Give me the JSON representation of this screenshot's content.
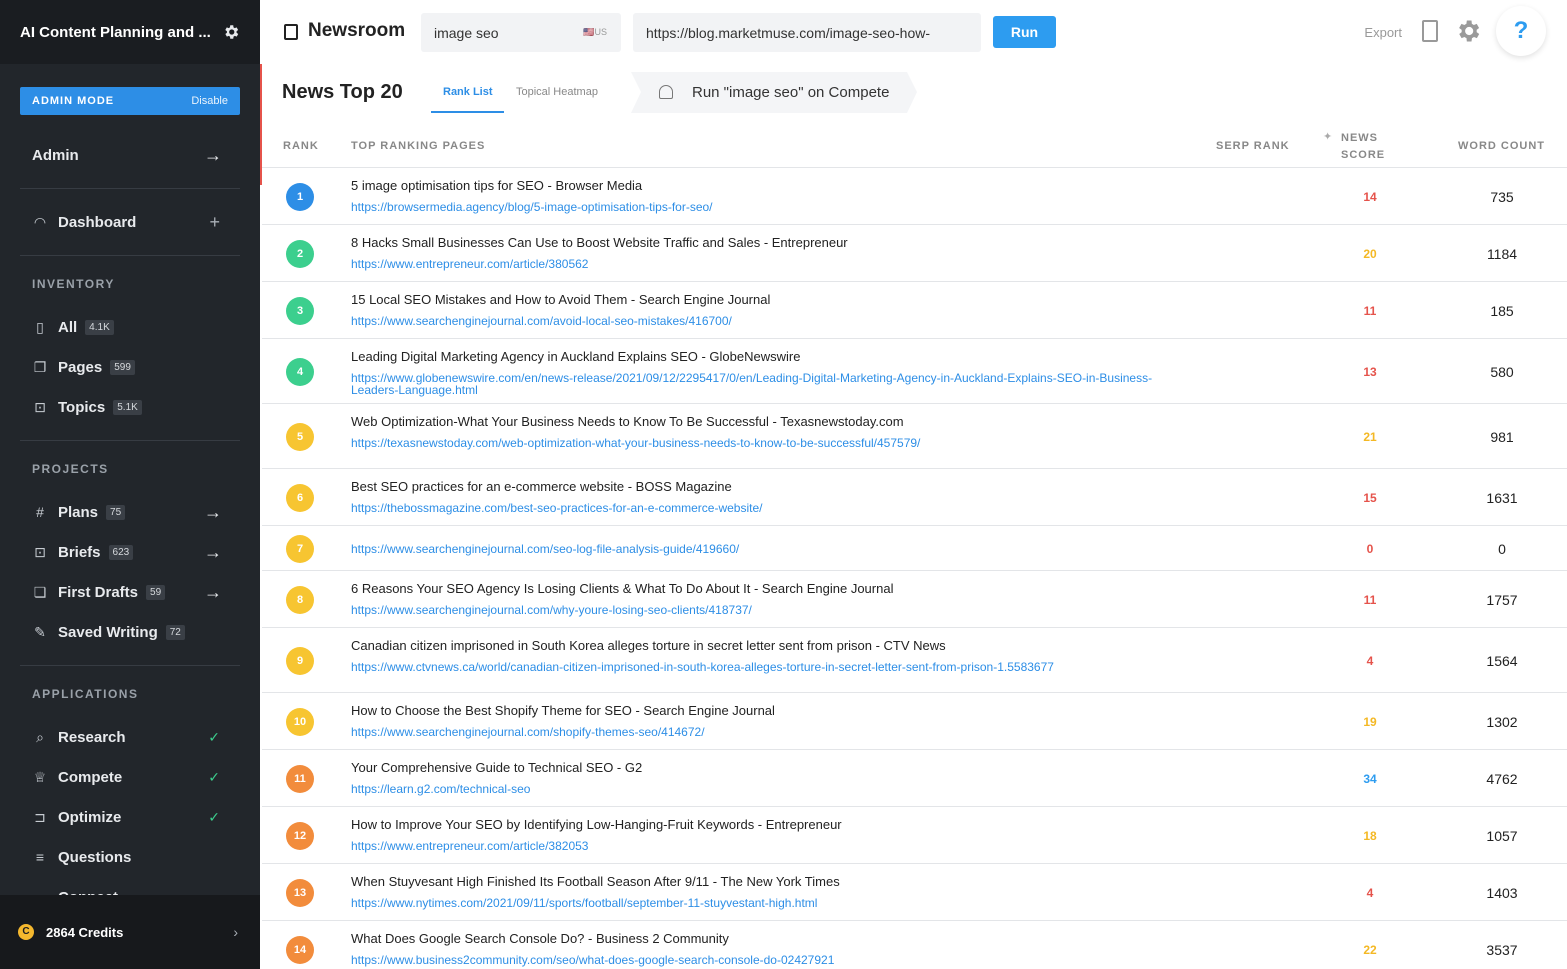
{
  "sidebar": {
    "title": "AI Content Planning and ...",
    "admin_mode_label": "ADMIN MODE",
    "admin_mode_action": "Disable",
    "admin_label": "Admin",
    "dashboard_label": "Dashboard",
    "inventory_heading": "INVENTORY",
    "inventory": [
      {
        "label": "All",
        "count": "4.1K",
        "icon": "bars-icon"
      },
      {
        "label": "Pages",
        "count": "599",
        "icon": "pages-icon"
      },
      {
        "label": "Topics",
        "count": "5.1K",
        "icon": "topics-icon"
      }
    ],
    "projects_heading": "PROJECTS",
    "projects": [
      {
        "label": "Plans",
        "count": "75",
        "icon": "hash-icon"
      },
      {
        "label": "Briefs",
        "count": "623",
        "icon": "brief-icon"
      },
      {
        "label": "First Drafts",
        "count": "59",
        "icon": "drafts-icon"
      },
      {
        "label": "Saved Writing",
        "count": "72",
        "icon": "edit-icon"
      }
    ],
    "applications_heading": "APPLICATIONS",
    "applications": [
      {
        "label": "Research",
        "icon": "search-icon"
      },
      {
        "label": "Compete",
        "icon": "trophy-icon"
      },
      {
        "label": "Optimize",
        "icon": "optimize-icon"
      },
      {
        "label": "Questions",
        "icon": "questions-icon"
      },
      {
        "label": "Connect",
        "icon": "connect-icon"
      }
    ],
    "credits": "2864 Credits",
    "credits_coin": "C"
  },
  "topbar": {
    "app_title": "Newsroom",
    "keyword": "image seo",
    "country": "🇺🇸US",
    "url": "https://blog.marketmuse.com/image-seo-how-",
    "run_label": "Run",
    "export_label": "Export",
    "help_label": "?"
  },
  "header": {
    "page_title": "News Top 20",
    "tabs": [
      "Rank List",
      "Topical Heatmap"
    ],
    "compete_action": "Run \"image seo\" on Compete"
  },
  "table": {
    "columns": {
      "rank": "RANK",
      "pages": "TOP RANKING PAGES",
      "serp": "SERP RANK",
      "news": "NEWS",
      "score": "SCORE",
      "wc": "WORD COUNT"
    },
    "rows": [
      {
        "rank": "1",
        "title": "5 image optimisation tips for SEO - Browser Media",
        "url": "https://browsermedia.agency/blog/5-image-optimisation-tips-for-seo/",
        "score": "14",
        "wc": "735"
      },
      {
        "rank": "2",
        "title": "8 Hacks Small Businesses Can Use to Boost Website Traffic and Sales - Entrepreneur",
        "url": "https://www.entrepreneur.com/article/380562",
        "score": "20",
        "wc": "1184"
      },
      {
        "rank": "3",
        "title": "15 Local SEO Mistakes and How to Avoid Them - Search Engine Journal",
        "url": "https://www.searchenginejournal.com/avoid-local-seo-mistakes/416700/",
        "score": "11",
        "wc": "185"
      },
      {
        "rank": "4",
        "title": "Leading Digital Marketing Agency in Auckland Explains SEO - GlobeNewswire",
        "url": "https://www.globenewswire.com/en/news-release/2021/09/12/2295417/0/en/Leading-Digital-Marketing-Agency-in-Auckland-Explains-SEO-in-Business-Leaders-Language.html",
        "score": "13",
        "wc": "580"
      },
      {
        "rank": "5",
        "title": "Web Optimization-What Your Business Needs to Know To Be Successful - Texasnewstoday.com",
        "url": "https://texasnewstoday.com/web-optimization-what-your-business-needs-to-know-to-be-successful/457579/",
        "score": "21",
        "wc": "981"
      },
      {
        "rank": "6",
        "title": "Best SEO practices for an e-commerce website - BOSS Magazine",
        "url": "https://thebossmagazine.com/best-seo-practices-for-an-e-commerce-website/",
        "score": "15",
        "wc": "1631"
      },
      {
        "rank": "7",
        "title": "",
        "url": "https://www.searchenginejournal.com/seo-log-file-analysis-guide/419660/",
        "score": "0",
        "wc": "0"
      },
      {
        "rank": "8",
        "title": "6 Reasons Your SEO Agency Is Losing Clients & What To Do About It - Search Engine Journal",
        "url": "https://www.searchenginejournal.com/why-youre-losing-seo-clients/418737/",
        "score": "11",
        "wc": "1757"
      },
      {
        "rank": "9",
        "title": "Canadian citizen imprisoned in South Korea alleges torture in secret letter sent from prison - CTV News",
        "url": "https://www.ctvnews.ca/world/canadian-citizen-imprisoned-in-south-korea-alleges-torture-in-secret-letter-sent-from-prison-1.5583677",
        "score": "4",
        "wc": "1564"
      },
      {
        "rank": "10",
        "title": "How to Choose the Best Shopify Theme for SEO - Search Engine Journal",
        "url": "https://www.searchenginejournal.com/shopify-themes-seo/414672/",
        "score": "19",
        "wc": "1302"
      },
      {
        "rank": "11",
        "title": "Your Comprehensive Guide to Technical SEO - G2",
        "url": "https://learn.g2.com/technical-seo",
        "score": "34",
        "wc": "4762"
      },
      {
        "rank": "12",
        "title": "How to Improve Your SEO by Identifying Low-Hanging-Fruit Keywords - Entrepreneur",
        "url": "https://www.entrepreneur.com/article/382053",
        "score": "18",
        "wc": "1057"
      },
      {
        "rank": "13",
        "title": "When Stuyvesant High Finished Its Football Season After 9/11 - The New York Times",
        "url": "https://www.nytimes.com/2021/09/11/sports/football/september-11-stuyvestant-high.html",
        "score": "4",
        "wc": "1403"
      },
      {
        "rank": "14",
        "title": "What Does Google Search Console Do? - Business 2 Community",
        "url": "https://www.business2community.com/seo/what-does-google-search-console-do-02427921",
        "score": "22",
        "wc": "3537"
      }
    ]
  },
  "colors": {
    "rank_blue": "#2d8ee6",
    "rank_green": "#3ccf8e",
    "rank_yellow": "#f7c531",
    "rank_orange": "#f28c3c",
    "score_red": "#e5534b",
    "score_yellow": "#f4b824",
    "score_blue": "#2d9cf0"
  }
}
